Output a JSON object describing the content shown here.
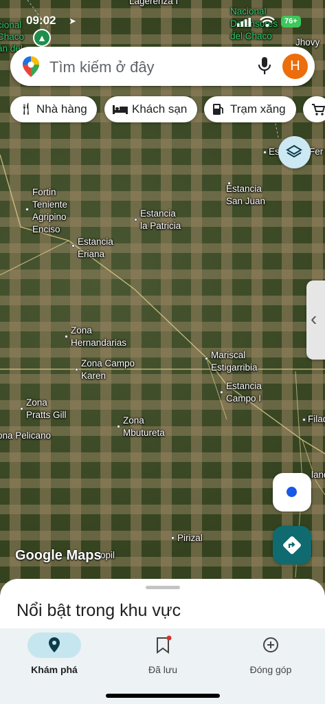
{
  "status_bar": {
    "time": "09:02",
    "battery": "76+"
  },
  "search": {
    "placeholder": "Tìm kiếm ở đây",
    "avatar_letter": "H"
  },
  "chips": [
    {
      "label": "Nhà hàng",
      "icon": "restaurant-icon"
    },
    {
      "label": "Khách sạn",
      "icon": "hotel-icon"
    },
    {
      "label": "Trạm xăng",
      "icon": "gas-station-icon"
    },
    {
      "label": "",
      "icon": "shopping-cart-icon"
    }
  ],
  "map_places": [
    {
      "name": "Lagerenza I"
    },
    {
      "name": "Nacional\nDefensores\ndel Chaco"
    },
    {
      "name": "cional\nChaco\nán del"
    },
    {
      "name": "Jhovy"
    },
    {
      "name": "Es"
    },
    {
      "name": "Fer"
    },
    {
      "name": "Fortin\nTeniente\nAgripino\nEnciso"
    },
    {
      "name": "Estancia\nla Patricia"
    },
    {
      "name": "Estancia\nSan Juan"
    },
    {
      "name": "Estancia\nEriana"
    },
    {
      "name": "Zona\nHernandarias"
    },
    {
      "name": "Zona Campo\nKaren"
    },
    {
      "name": "Mariscal\nEstigarribia"
    },
    {
      "name": "Estancia\nCampo I"
    },
    {
      "name": "Filad"
    },
    {
      "name": "Zona\nPratts Gill"
    },
    {
      "name": "ona Pelicano"
    },
    {
      "name": "Zona\nMbutureta"
    },
    {
      "name": "landa"
    },
    {
      "name": "Pirizal"
    },
    {
      "name": "opil"
    }
  ],
  "map_brand": "Google Maps",
  "sheet": {
    "title": "Nổi bật trong khu vực"
  },
  "nav": [
    {
      "label": "Khám phá",
      "icon": "explore-pin-icon"
    },
    {
      "label": "Đã lưu",
      "icon": "bookmark-icon"
    },
    {
      "label": "Đóng góp",
      "icon": "add-circle-icon"
    }
  ],
  "colors": {
    "accent": "#0f6b70",
    "avatar": "#ec6d0b",
    "nav_active": "#c6e6ef",
    "location_dot": "#1a58e6",
    "park": "#2fd06b"
  }
}
